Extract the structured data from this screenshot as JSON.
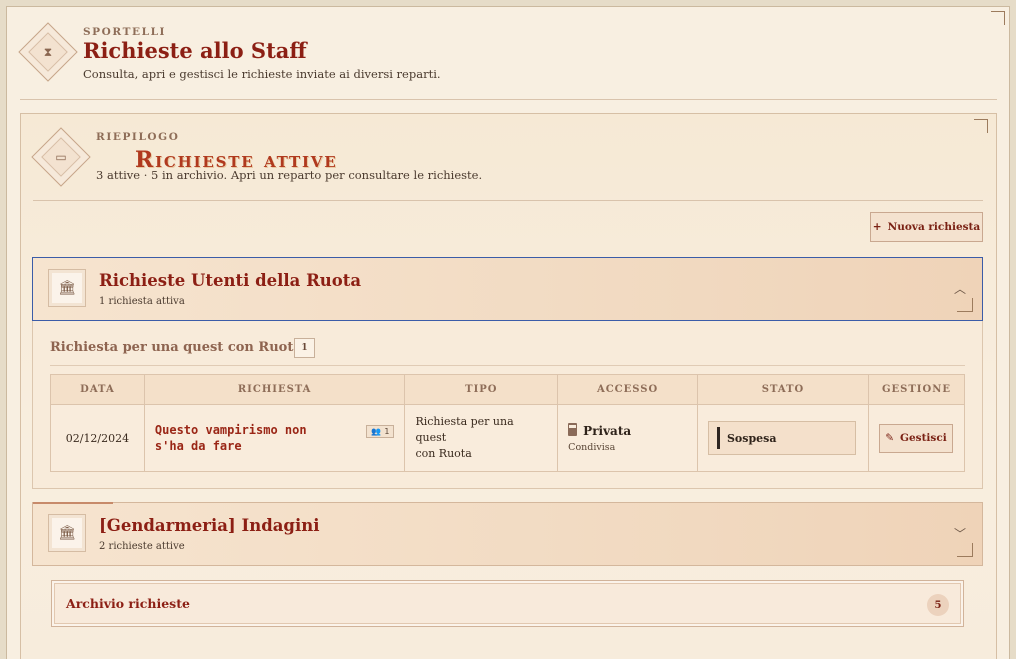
{
  "header": {
    "eyebrow": "SPORTELLI",
    "title": "Richieste allo Staff",
    "subtitle": "Consulta, apri e gestisci le richieste inviate ai diversi reparti."
  },
  "summary": {
    "eyebrow": "RIEPILOGO",
    "title": "Richieste attive",
    "subtitle": "3 attive · 5 in archivio. Apri un reparto per consultare le richieste.",
    "new_button": "Nuova richiesta"
  },
  "departments": [
    {
      "title": "Richieste Utenti della Ruota",
      "count_label": "1 richiesta attiva",
      "expanded": true,
      "groups": [
        {
          "title": "Richiesta per una quest con Ruota",
          "count": "1",
          "columns": [
            "DATA",
            "RICHIESTA",
            "TIPO",
            "ACCESSO",
            "STATO",
            "GESTIONE"
          ],
          "rows": [
            {
              "date": "02/12/2024",
              "request_line1": "Questo vampirismo non",
              "request_line2": "s'ha da fare",
              "participants": "1",
              "type_line1": "Richiesta per una quest",
              "type_line2": "con Ruota",
              "access": "Privata",
              "access_sub": "Condivisa",
              "status": "Sospesa",
              "action": "Gestisci"
            }
          ]
        }
      ]
    },
    {
      "title": "[Gendarmeria] Indagini",
      "count_label": "2 richieste attive",
      "expanded": false
    }
  ],
  "archive": {
    "label": "Archivio richieste",
    "count": "5"
  },
  "icons": {
    "header": "hourglass-icon",
    "summary": "inbox-icon",
    "department": "bank-icon",
    "access": "lock-icon",
    "participants": "people-icon",
    "action": "pencil-icon",
    "new": "plus-icon"
  },
  "colors": {
    "accent": "#8c1f14",
    "focus": "#3b5ca8",
    "background": "#f8efe1"
  }
}
